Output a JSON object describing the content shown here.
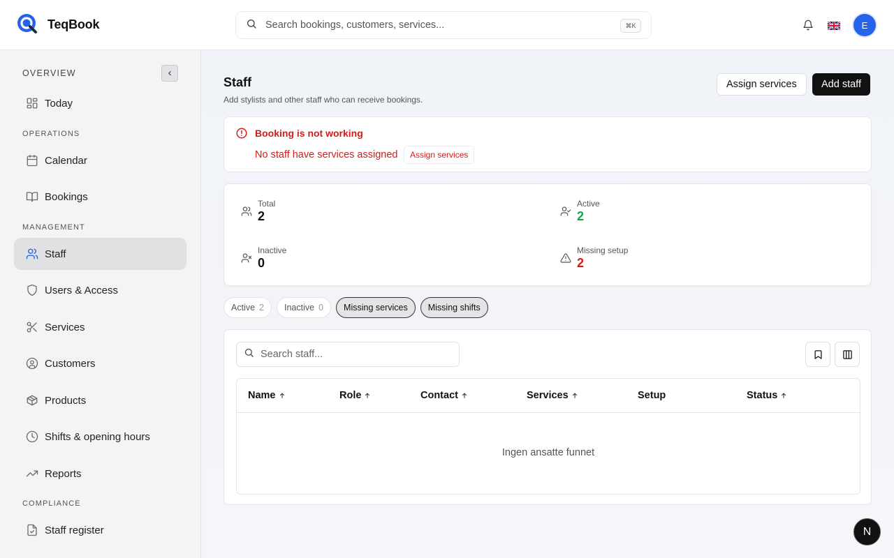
{
  "app": {
    "name": "TeqBook"
  },
  "header": {
    "search_placeholder": "Search bookings, customers, services...",
    "search_shortcut": "⌘K",
    "avatar_initial": "E"
  },
  "sidebar": {
    "sections": {
      "overview": "OVERVIEW",
      "operations": "OPERATIONS",
      "management": "MANAGEMENT",
      "compliance": "COMPLIANCE"
    },
    "items": [
      {
        "label": "Today",
        "icon": "layout-dashboard-icon"
      },
      {
        "label": "Calendar",
        "icon": "calendar-icon"
      },
      {
        "label": "Bookings",
        "icon": "book-open-icon"
      },
      {
        "label": "Staff",
        "icon": "users-icon",
        "active": true
      },
      {
        "label": "Users & Access",
        "icon": "shield-icon"
      },
      {
        "label": "Services",
        "icon": "scissors-icon"
      },
      {
        "label": "Customers",
        "icon": "user-circle-icon"
      },
      {
        "label": "Products",
        "icon": "package-icon"
      },
      {
        "label": "Shifts & opening hours",
        "icon": "clock-icon"
      },
      {
        "label": "Reports",
        "icon": "trending-up-icon"
      },
      {
        "label": "Staff register",
        "icon": "file-check-icon"
      }
    ]
  },
  "page": {
    "title": "Staff",
    "subtitle": "Add stylists and other staff who can receive bookings.",
    "assign_services_label": "Assign services",
    "add_staff_label": "Add staff"
  },
  "alert": {
    "title": "Booking is not working",
    "message": "No staff have services assigned",
    "action_label": "Assign services"
  },
  "stats": {
    "total": {
      "label": "Total",
      "value": "2"
    },
    "active": {
      "label": "Active",
      "value": "2"
    },
    "inactive": {
      "label": "Inactive",
      "value": "0"
    },
    "missing_setup": {
      "label": "Missing setup",
      "value": "2"
    }
  },
  "filters": {
    "active": {
      "label": "Active",
      "count": "2"
    },
    "inactive": {
      "label": "Inactive",
      "count": "0"
    },
    "missing_services": {
      "label": "Missing services"
    },
    "missing_shifts": {
      "label": "Missing shifts"
    }
  },
  "table": {
    "search_placeholder": "Search staff...",
    "columns": [
      "Name",
      "Role",
      "Contact",
      "Services",
      "Setup",
      "Status"
    ],
    "empty_message": "Ingen ansatte funnet"
  },
  "colors": {
    "accent": "#2563eb",
    "danger": "#d61a1a",
    "success": "#16a34a"
  },
  "fab": {
    "label": "N"
  }
}
